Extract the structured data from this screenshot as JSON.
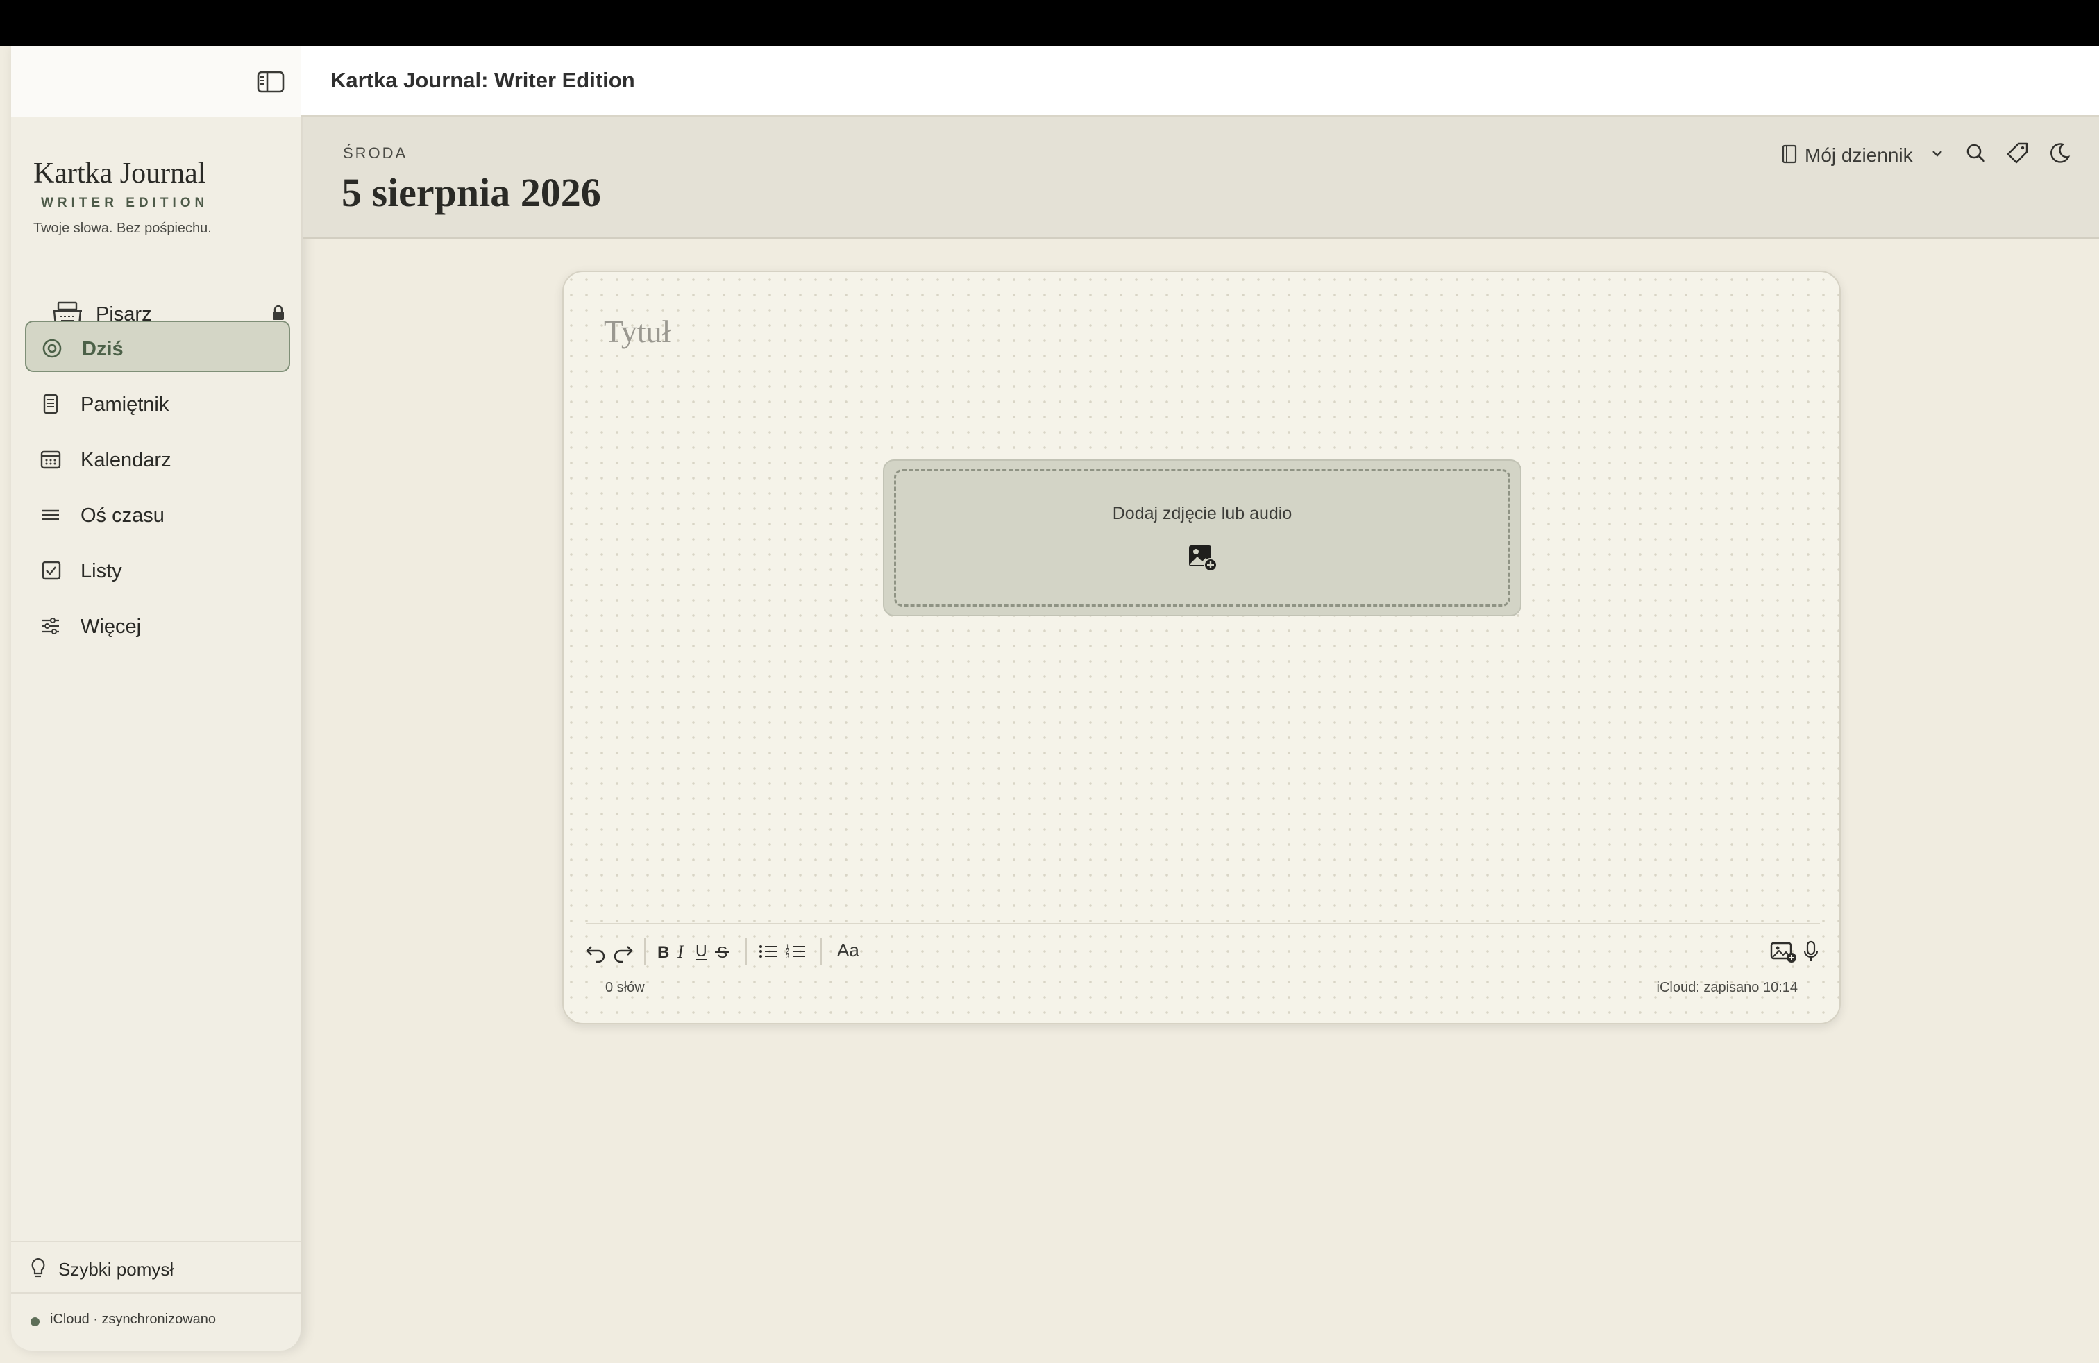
{
  "window": {
    "title": "Kartka Journal: Writer Edition"
  },
  "sidebar": {
    "brand_name": "Kartka Journal",
    "brand_edition": "WRITER EDITION",
    "tagline": "Twoje słowa. Bez pośpiechu.",
    "items": [
      {
        "label": "Pisarz",
        "icon": "typewriter-icon",
        "locked": true
      },
      {
        "label": "Dziś",
        "icon": "target-icon",
        "active": true
      },
      {
        "label": "Pamiętnik",
        "icon": "notebook-icon"
      },
      {
        "label": "Kalendarz",
        "icon": "calendar-icon"
      },
      {
        "label": "Oś czasu",
        "icon": "lines-icon"
      },
      {
        "label": "Listy",
        "icon": "checkbox-icon"
      },
      {
        "label": "Więcej",
        "icon": "sliders-icon"
      }
    ],
    "quick_idea": "Szybki pomysł",
    "sync_status": "iCloud · zsynchronizowano"
  },
  "header": {
    "weekday": "ŚRODA",
    "date": "5 sierpnia 2026",
    "journal_selector": "Mój dziennik"
  },
  "editor": {
    "title_placeholder": "Tytuł",
    "media_prompt": "Dodaj zdjęcie lub audio",
    "font_button": "Aa",
    "word_count": "0 słów",
    "save_status": "iCloud: zapisano 10:14"
  },
  "colors": {
    "accent": "#4c6148",
    "active_bg": "#d4d6c6",
    "page_bg": "#f0ece0",
    "card_bg": "#f5f3e9"
  }
}
